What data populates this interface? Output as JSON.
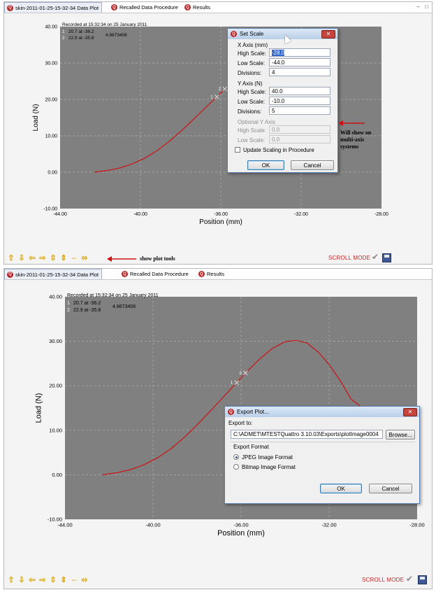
{
  "tabs": [
    {
      "label": "skin-2011-01-25-15-32-34 Data Plot"
    },
    {
      "label": "Recalled Data Procedure"
    },
    {
      "label": "Results"
    }
  ],
  "colors": {
    "plot_bg": "#808080",
    "curve": "#cc1111",
    "scroll_mode": "#cc2222",
    "panel_bg": "#f4f4f4"
  },
  "panel1": {
    "recorded": "Recorded at 15:32:34 on 25 January 2011",
    "legend": [
      {
        "num": "1",
        "text": "20.7  at  -36.2"
      },
      {
        "num": "2",
        "text": "22.9  at  -35.8"
      }
    ],
    "delta": "4.8673406",
    "scroll_mode": "SCROLL MODE",
    "annotation_tools": "show plot tools",
    "annotation_multi": [
      "Will show on",
      "multi-axis",
      "systems"
    ],
    "set_scale": {
      "title": "Set Scale",
      "x_axis_label": "X Axis (mm)",
      "x_high_label": "High Scale:",
      "x_high": "-28.0",
      "x_low_label": "Low Scale:",
      "x_low": "-44.0",
      "x_div_label": "Divisions:",
      "x_div": "4",
      "y_axis_label": "Y Axis (N)",
      "y_high_label": "High Scale:",
      "y_high": "40.0",
      "y_low_label": "Low Scale:",
      "y_low": "-10.0",
      "y_div_label": "Divisions:",
      "y_div": "5",
      "opt_y_label": "Optional Y Axis",
      "opt_high_label": "High Scale:",
      "opt_high": "0.0",
      "opt_low_label": "Low Scale:",
      "opt_low": "0.0",
      "update_label": "Update Scaling in Procedure",
      "ok": "OK",
      "cancel": "Cancel"
    }
  },
  "panel2": {
    "recorded": "Recorded at 15:32:34 on 25 January 2011",
    "legend": [
      {
        "num": "1",
        "text": "20.7  at  -36.2"
      },
      {
        "num": "2",
        "text": "22.9  at  -35.8"
      }
    ],
    "delta": "4.8673406",
    "scroll_mode": "SCROLL MODE",
    "export": {
      "title": "Export Plot...",
      "export_to_label": "Export to:",
      "path": "C:\\ADMET\\MTESTQuattro 3.10.03\\Exports\\plotImage0004",
      "browse": "Browse...",
      "format_label": "Export Format",
      "jpeg": "JPEG Image Format",
      "bitmap": "Bitmap Image Format",
      "ok": "OK",
      "cancel": "Cancel"
    }
  },
  "chart_data": [
    {
      "type": "line",
      "xlabel": "Position (mm)",
      "ylabel": "Load (N)",
      "xlim": [
        -44,
        -28
      ],
      "ylim": [
        -10,
        40
      ],
      "xticks": [
        "-44.00",
        "-40.00",
        "-36.00",
        "-32.00",
        "-28.00"
      ],
      "yticks": [
        "40.00",
        "30.00",
        "20.00",
        "10.00",
        "0.00",
        "-10.00"
      ],
      "grid": true,
      "series": [
        {
          "x": [
            -42.3,
            -41.6,
            -41.0,
            -40.4,
            -39.8,
            -39.2,
            -38.6,
            -38.0,
            -37.4,
            -36.8,
            -36.2,
            -35.8
          ],
          "y": [
            0.0,
            0.5,
            1.2,
            2.3,
            3.8,
            5.8,
            8.3,
            11.2,
            14.3,
            17.5,
            20.7,
            22.9
          ]
        }
      ],
      "markers": [
        {
          "label": "1",
          "x": -36.2,
          "y": 20.7
        },
        {
          "label": "2",
          "x": -35.8,
          "y": 22.9
        }
      ]
    },
    {
      "type": "line",
      "xlabel": "Position (mm)",
      "ylabel": "Load (N)",
      "xlim": [
        -44,
        -28
      ],
      "ylim": [
        -10,
        40
      ],
      "xticks": [
        "-44.00",
        "-40.00",
        "-36.00",
        "-32.00",
        "-28.00"
      ],
      "yticks": [
        "40.00",
        "30.00",
        "20.00",
        "10.00",
        "0.00",
        "-10.00"
      ],
      "grid": true,
      "series": [
        {
          "x": [
            -42.3,
            -41.6,
            -41.0,
            -40.4,
            -39.8,
            -39.2,
            -38.6,
            -38.0,
            -37.4,
            -36.8,
            -36.2,
            -35.8,
            -35.2,
            -34.6,
            -34.0,
            -33.5,
            -33.0,
            -32.5,
            -32.0,
            -31.5,
            -31.0,
            -30.6
          ],
          "y": [
            0.0,
            0.5,
            1.2,
            2.3,
            3.8,
            5.8,
            8.3,
            11.2,
            14.3,
            17.5,
            20.7,
            22.9,
            25.8,
            28.3,
            29.9,
            30.2,
            29.6,
            27.6,
            24.8,
            21.2,
            17.0,
            15.5
          ]
        }
      ],
      "markers": [
        {
          "label": "1",
          "x": -36.2,
          "y": 20.7
        },
        {
          "label": "2",
          "x": -35.8,
          "y": 22.9
        }
      ]
    }
  ]
}
